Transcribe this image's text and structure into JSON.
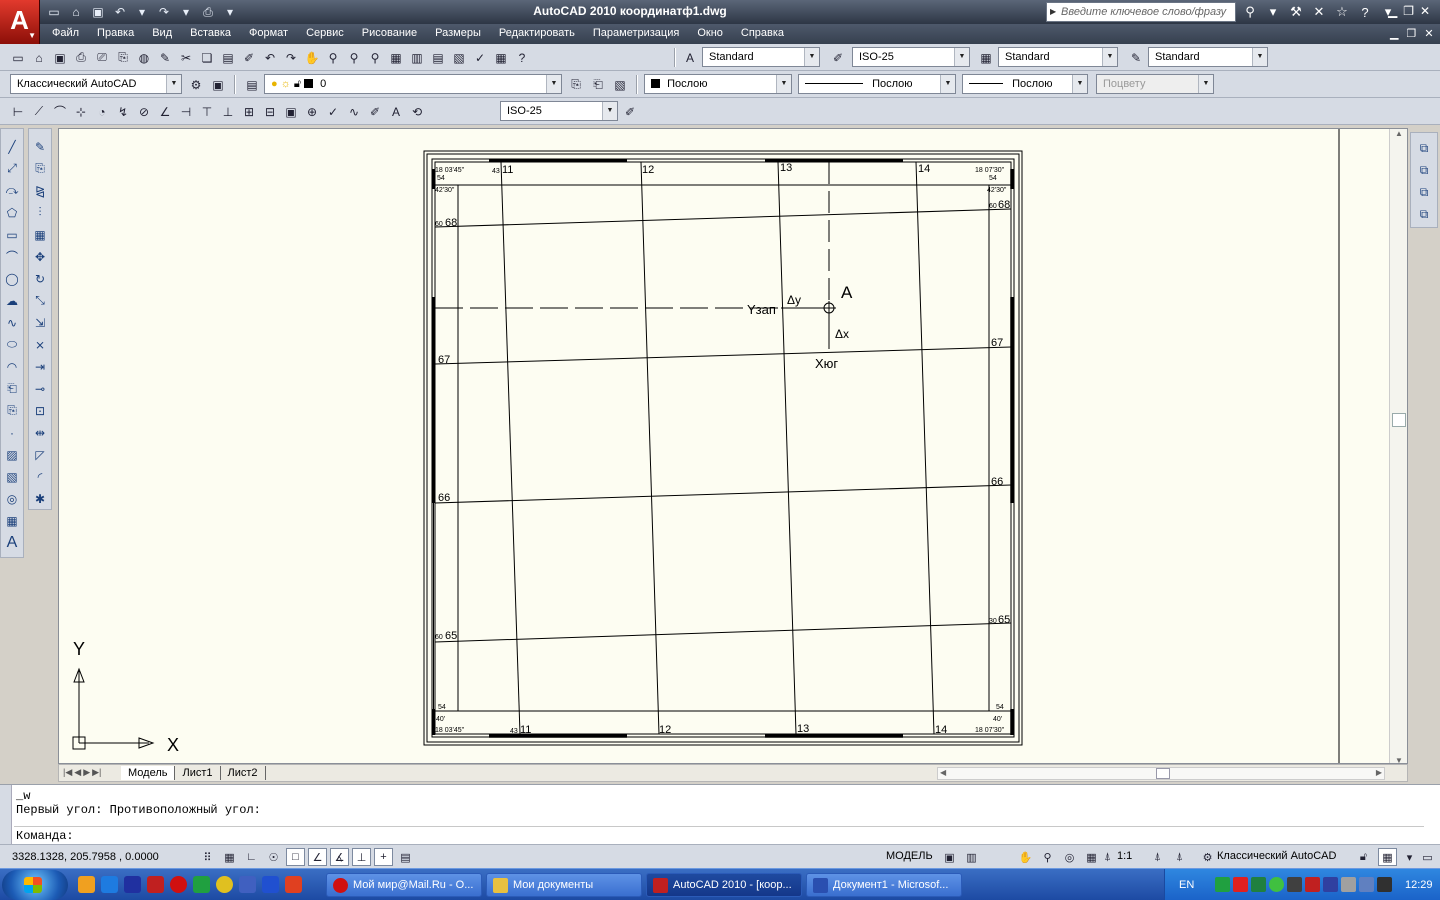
{
  "window": {
    "app_logo": "A",
    "title": "AutoCAD 2010    координатф1.dwg",
    "search_placeholder": "Введите ключевое слово/фразу"
  },
  "menu": {
    "items": [
      "Файл",
      "Правка",
      "Вид",
      "Вставка",
      "Формат",
      "Сервис",
      "Рисование",
      "Размеры",
      "Редактировать",
      "Параметризация",
      "Окно",
      "Справка"
    ]
  },
  "toolbar1": {
    "text_style": "Standard",
    "dim_style": "ISO-25",
    "table_style": "Standard",
    "mleader_style": "Standard"
  },
  "toolbar2": {
    "workspace": "Классический AutoCAD",
    "layer": "0",
    "color": "Послою",
    "linetype": "Послою",
    "lineweight": "Послою",
    "plotstyle": "Поцвету"
  },
  "toolbar3": {
    "dim_style": "ISO-25"
  },
  "drawing": {
    "grid_numbers_top": [
      "11",
      "12",
      "13",
      "14"
    ],
    "grid_numbers_bottom": [
      "11",
      "12",
      "13",
      "14"
    ],
    "grid_numbers_left": [
      "68",
      "67",
      "66",
      "65"
    ],
    "grid_numbers_right": [
      "68",
      "67",
      "66",
      "65"
    ],
    "corner_top_left": [
      "18 03'45\"",
      "54",
      "42'30\""
    ],
    "corner_top_right": [
      "18 07'30\"",
      "54",
      "42'30\""
    ],
    "corner_bottom_left": [
      "54",
      "40'",
      "18 03'45\""
    ],
    "corner_bottom_right": [
      "54",
      "40'",
      "18 07'30\""
    ],
    "small_prefix_top": "43",
    "small_prefix_bottom": "43",
    "small_prefix_left_top": "60",
    "small_prefix_left_bottom": "60",
    "small_prefix_right_top": "60",
    "small_prefix_right_bottom": "30",
    "point_label": "A",
    "label_yzap": "Yзап",
    "label_dy": "Δy",
    "label_dx": "Δx",
    "label_xyug": "Xюг",
    "ucs_x": "X",
    "ucs_y": "Y"
  },
  "tabs": [
    "Модель",
    "Лист1",
    "Лист2"
  ],
  "command": {
    "line1": "_w",
    "line2": "Первый угол: Противоположный угол:",
    "prompt": "Команда:"
  },
  "status": {
    "coords": "3328.1328, 205.7958 , 0.0000",
    "model": "МОДЕЛЬ",
    "scale": "1:1",
    "workspace": "Классический AutoCAD"
  },
  "taskbar": {
    "tasks": [
      "Мой мир@Mail.Ru - О...",
      "Мои документы",
      "AutoCAD 2010 - [коор...",
      "Документ1 - Microsof..."
    ],
    "language": "EN",
    "clock": "12:29"
  }
}
